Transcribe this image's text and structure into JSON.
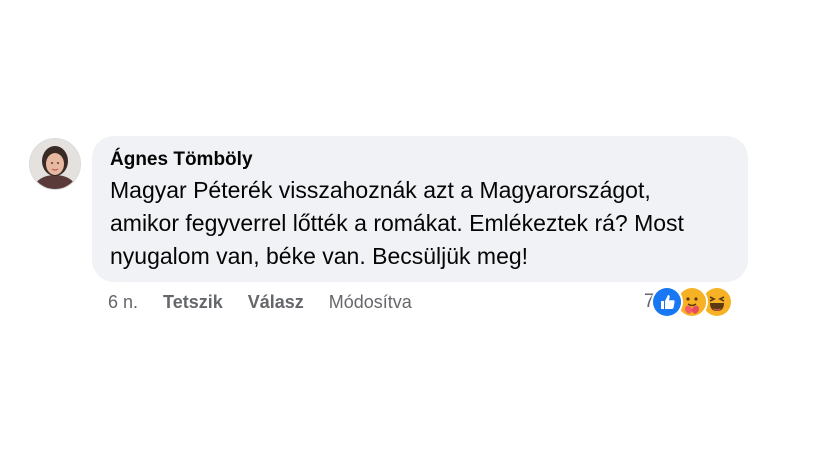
{
  "comment": {
    "author": "Ágnes Tömböly",
    "text_lines": [
      "Magyar Péterék visszahoznák azt a Magyarországot,",
      "amikor fegyverrel lőtték a romákat. Emlékeztek rá? Most",
      "nyugalom van, béke van. Becsüljük meg!"
    ]
  },
  "actions": {
    "time": "6 n.",
    "like_label": "Tetszik",
    "reply_label": "Válasz",
    "edited_label": "Módosítva"
  },
  "reactions": {
    "count": "7",
    "icons": [
      "like-icon",
      "care-icon",
      "haha-icon"
    ],
    "colors": {
      "like": "#1877f2",
      "care": "#f7b125",
      "haha": "#f7b125"
    }
  },
  "colors": {
    "bubble_bg": "#f0f2f5",
    "text": "#050505",
    "secondary": "#65676b"
  }
}
